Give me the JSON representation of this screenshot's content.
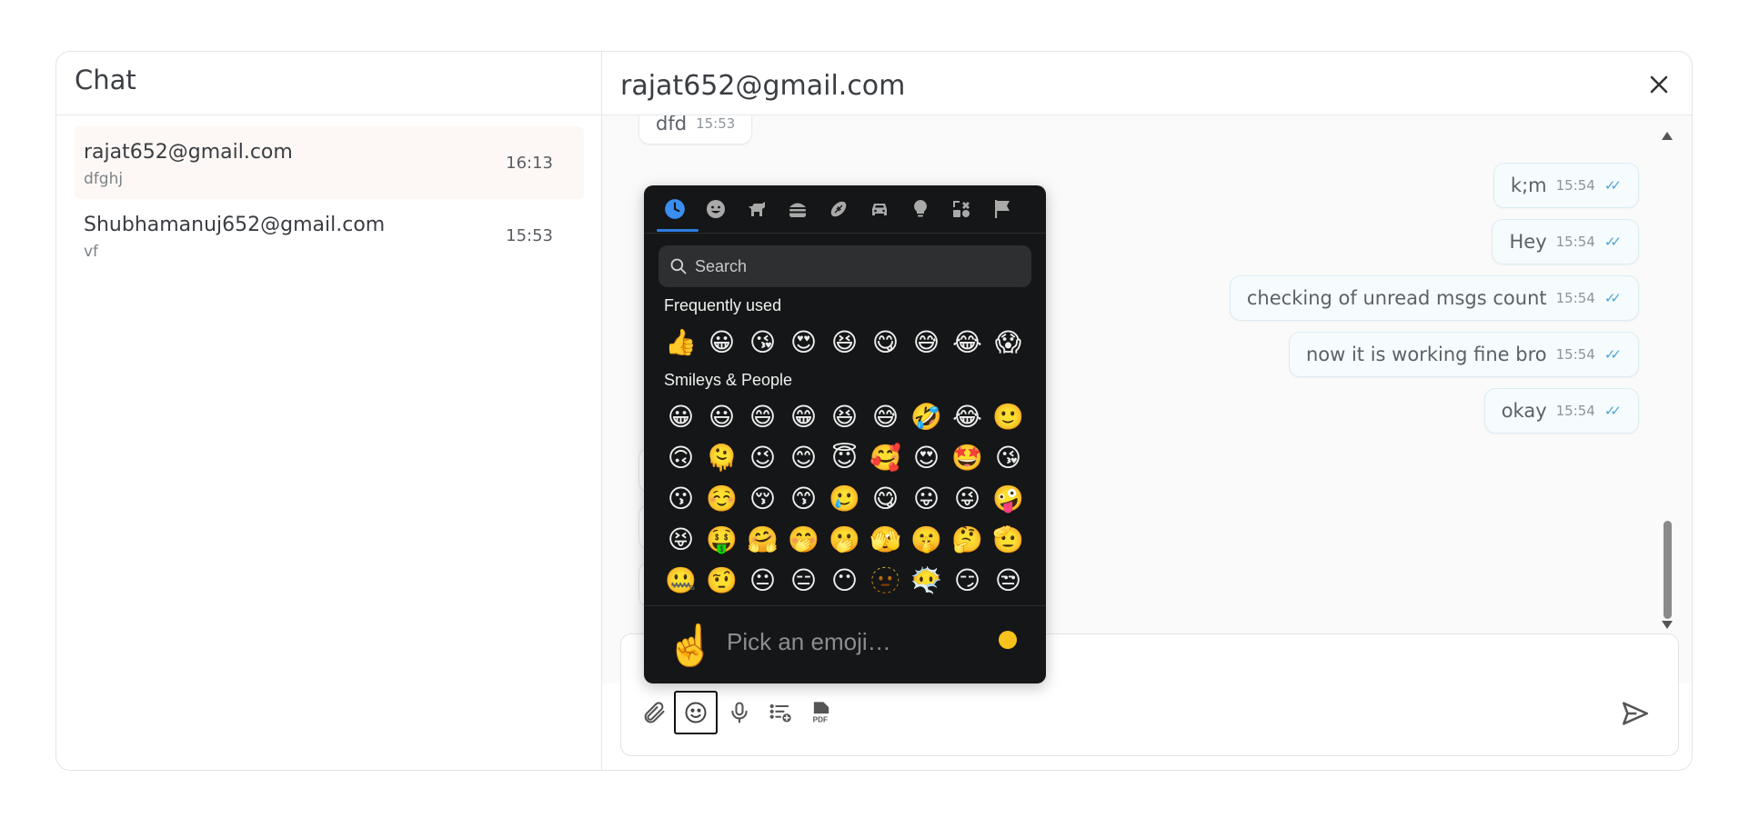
{
  "sidebar": {
    "title": "Chat",
    "conversations": [
      {
        "name": "rajat652@gmail.com",
        "preview": "dfghj",
        "time": "16:13",
        "active": true
      },
      {
        "name": "Shubhamanuj652@gmail.com",
        "preview": "vf",
        "time": "15:53",
        "active": false
      }
    ]
  },
  "chat": {
    "title": "rajat652@gmail.com",
    "incoming_top": {
      "text": "dfd",
      "time": "15:53"
    },
    "outgoing": [
      {
        "text": "k;m",
        "time": "15:54"
      },
      {
        "text": "Hey",
        "time": "15:54"
      },
      {
        "text": "checking of unread msgs count",
        "time": "15:54"
      },
      {
        "text": "now it is working fine bro",
        "time": "15:54"
      },
      {
        "text": "okay",
        "time": "15:54"
      }
    ]
  },
  "composer": {
    "tools": [
      "attach-icon",
      "emoji-icon",
      "microphone-icon",
      "list-add-icon",
      "pdf-icon"
    ],
    "selected_tool": "emoji-icon",
    "send": "send-icon"
  },
  "emoji_picker": {
    "categories": [
      "recent",
      "smileys",
      "animals",
      "food",
      "activities",
      "travel",
      "objects",
      "symbols",
      "flags"
    ],
    "active_category": "recent",
    "search_placeholder": "Search",
    "sections": [
      {
        "label": "Frequently used",
        "emojis": [
          "👍",
          "😀",
          "😘",
          "😍",
          "😆",
          "😋",
          "😅",
          "😂",
          "😱"
        ]
      },
      {
        "label": "Smileys & People",
        "emojis": [
          "😀",
          "😃",
          "😄",
          "😁",
          "😆",
          "😅",
          "🤣",
          "😂",
          "🙂",
          "🙃",
          "🫠",
          "😉",
          "😊",
          "😇",
          "🥰",
          "😍",
          "🤩",
          "😘",
          "😗",
          "☺️",
          "😚",
          "😙",
          "🥲",
          "😋",
          "😛",
          "😜",
          "🤪",
          "😝",
          "🤑",
          "🤗",
          "🤭",
          "🫢",
          "🫣",
          "🤫",
          "🤔",
          "🫡",
          "🤐",
          "🤨",
          "😐",
          "😑",
          "😶",
          "🫥",
          "😶‍🌫️",
          "😏",
          "😒"
        ]
      }
    ],
    "preview_emoji": "☝️",
    "preview_text": "Pick an emoji…",
    "skin_tone_color": "#f7c21b"
  }
}
